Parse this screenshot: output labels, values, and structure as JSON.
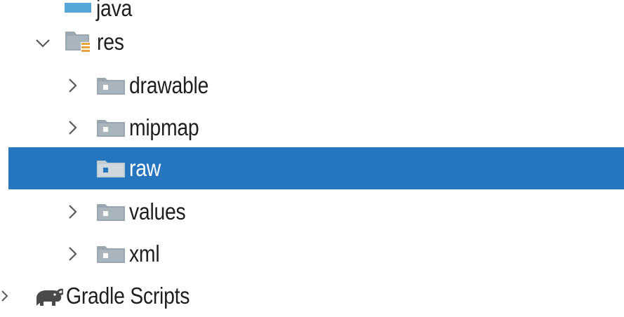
{
  "colors": {
    "selection_bg": "#2675bf",
    "folder_gray": "#9aa7b0",
    "folder_light": "#c1ccd3",
    "res_badge": "#e8a33d",
    "java_folder": "#55a7d7",
    "text": "#1f1f1f",
    "chevron": "#5a5a5a",
    "gradle_icon": "#4a4a4a"
  },
  "tree": {
    "java_label": "java",
    "res_label": "res",
    "items": [
      {
        "label": "drawable",
        "expander": "chevron-right-icon",
        "icon": "resource-folder-icon"
      },
      {
        "label": "mipmap",
        "expander": "chevron-right-icon",
        "icon": "resource-folder-icon"
      },
      {
        "label": "raw",
        "expander": "none",
        "icon": "resource-folder-icon",
        "selected": true
      },
      {
        "label": "values",
        "expander": "chevron-right-icon",
        "icon": "resource-folder-icon"
      },
      {
        "label": "xml",
        "expander": "chevron-right-icon",
        "icon": "resource-folder-icon"
      }
    ],
    "gradle_label": "Gradle Scripts"
  }
}
